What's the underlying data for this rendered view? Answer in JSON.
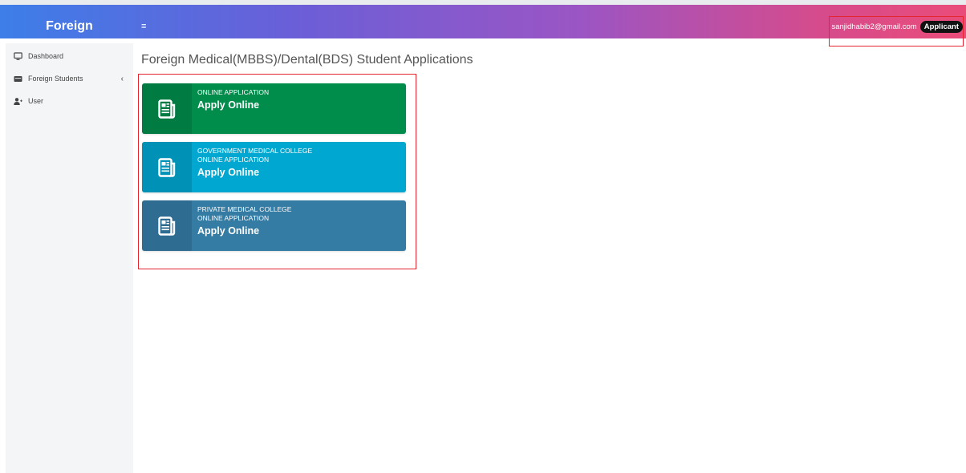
{
  "header": {
    "brand": "Foreign",
    "menu_toggle": "≡",
    "user_email": "sanjidhabib2@gmail.com",
    "role": "Applicant"
  },
  "sidebar": {
    "items": [
      {
        "label": "Dashboard",
        "icon": "monitor-icon"
      },
      {
        "label": "Foreign Students",
        "icon": "id-card-icon",
        "arrow": "‹"
      },
      {
        "label": "User",
        "icon": "user-plus-icon"
      }
    ]
  },
  "main": {
    "title": "Foreign Medical(MBBS)/Dental(BDS) Student Applications",
    "cards": [
      {
        "lines": [
          "ONLINE APPLICATION"
        ],
        "action": "Apply Online",
        "color": "#008d4c",
        "icon": "newspaper-icon"
      },
      {
        "lines": [
          "GOVERNMENT MEDICAL COLLEGE",
          "ONLINE APPLICATION"
        ],
        "action": "Apply Online",
        "color": "#00a7d0",
        "icon": "newspaper-icon"
      },
      {
        "lines": [
          "PRIVATE MEDICAL COLLEGE",
          "ONLINE APPLICATION"
        ],
        "action": "Apply Online",
        "color": "#357ca5",
        "icon": "newspaper-icon"
      }
    ]
  },
  "colors": {
    "highlight": "#e3252f",
    "sidebar_bg": "#f4f5f7"
  }
}
